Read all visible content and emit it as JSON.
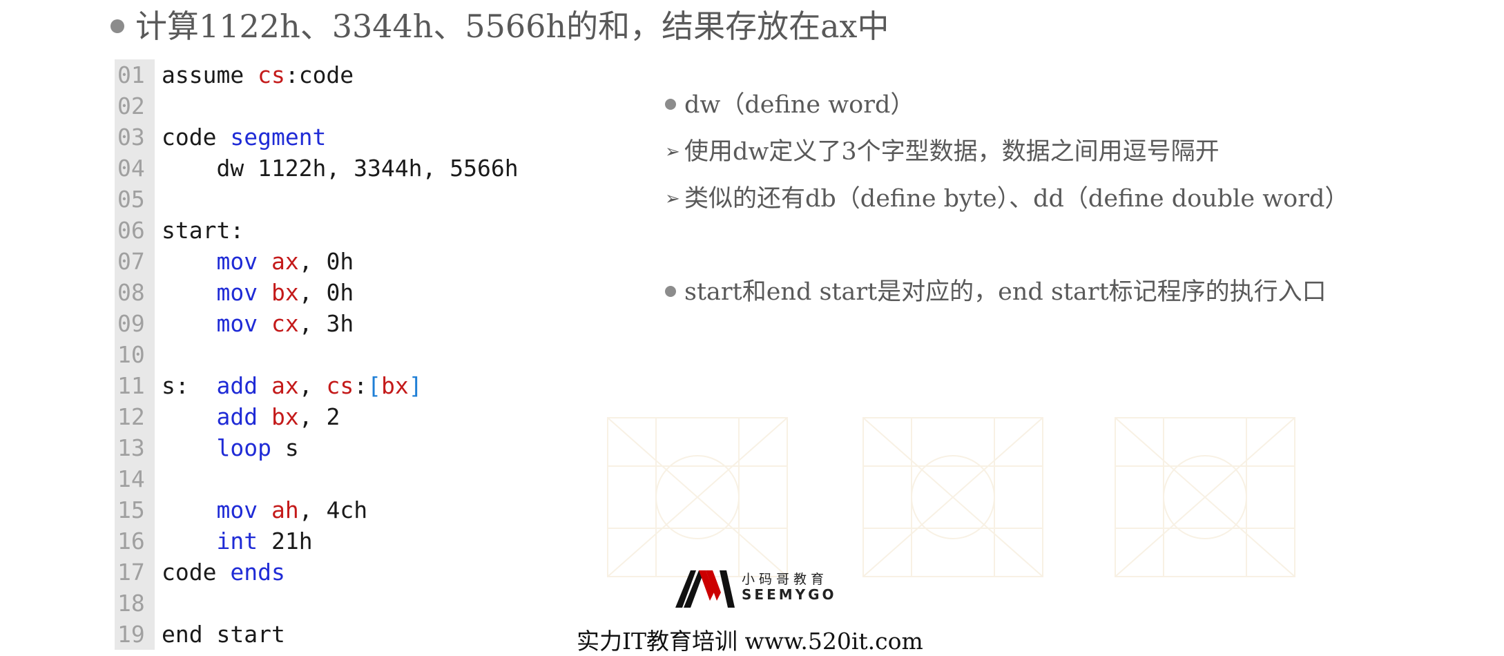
{
  "title": "计算1122h、3344h、5566h的和，结果存放在ax中",
  "code_lines": [
    {
      "num": "01",
      "tokens": [
        {
          "t": "assume ",
          "c": "n"
        },
        {
          "t": "cs",
          "c": "reg"
        },
        {
          "t": ":code",
          "c": "n"
        }
      ]
    },
    {
      "num": "02",
      "tokens": []
    },
    {
      "num": "03",
      "tokens": [
        {
          "t": "code ",
          "c": "n"
        },
        {
          "t": "segment",
          "c": "kw"
        }
      ]
    },
    {
      "num": "04",
      "tokens": [
        {
          "t": "    dw 1122h, 3344h, 5566h",
          "c": "n"
        }
      ]
    },
    {
      "num": "05",
      "tokens": []
    },
    {
      "num": "06",
      "tokens": [
        {
          "t": "start:",
          "c": "n"
        }
      ]
    },
    {
      "num": "07",
      "tokens": [
        {
          "t": "    ",
          "c": "n"
        },
        {
          "t": "mov",
          "c": "kw"
        },
        {
          "t": " ",
          "c": "n"
        },
        {
          "t": "ax",
          "c": "reg"
        },
        {
          "t": ", 0h",
          "c": "n"
        }
      ]
    },
    {
      "num": "08",
      "tokens": [
        {
          "t": "    ",
          "c": "n"
        },
        {
          "t": "mov",
          "c": "kw"
        },
        {
          "t": " ",
          "c": "n"
        },
        {
          "t": "bx",
          "c": "reg"
        },
        {
          "t": ", 0h",
          "c": "n"
        }
      ]
    },
    {
      "num": "09",
      "tokens": [
        {
          "t": "    ",
          "c": "n"
        },
        {
          "t": "mov",
          "c": "kw"
        },
        {
          "t": " ",
          "c": "n"
        },
        {
          "t": "cx",
          "c": "reg"
        },
        {
          "t": ", 3h",
          "c": "n"
        }
      ]
    },
    {
      "num": "10",
      "tokens": []
    },
    {
      "num": "11",
      "tokens": [
        {
          "t": "s:  ",
          "c": "n"
        },
        {
          "t": "add",
          "c": "kw"
        },
        {
          "t": " ",
          "c": "n"
        },
        {
          "t": "ax",
          "c": "reg"
        },
        {
          "t": ", ",
          "c": "n"
        },
        {
          "t": "cs",
          "c": "reg"
        },
        {
          "t": ":",
          "c": "n"
        },
        {
          "t": "[",
          "c": "br"
        },
        {
          "t": "bx",
          "c": "reg"
        },
        {
          "t": "]",
          "c": "br"
        }
      ]
    },
    {
      "num": "12",
      "tokens": [
        {
          "t": "    ",
          "c": "n"
        },
        {
          "t": "add",
          "c": "kw"
        },
        {
          "t": " ",
          "c": "n"
        },
        {
          "t": "bx",
          "c": "reg"
        },
        {
          "t": ", 2",
          "c": "n"
        }
      ]
    },
    {
      "num": "13",
      "tokens": [
        {
          "t": "    ",
          "c": "n"
        },
        {
          "t": "loop",
          "c": "kw"
        },
        {
          "t": " s",
          "c": "n"
        }
      ]
    },
    {
      "num": "14",
      "tokens": []
    },
    {
      "num": "15",
      "tokens": [
        {
          "t": "    ",
          "c": "n"
        },
        {
          "t": "mov",
          "c": "kw"
        },
        {
          "t": " ",
          "c": "n"
        },
        {
          "t": "ah",
          "c": "reg"
        },
        {
          "t": ", 4ch",
          "c": "n"
        }
      ]
    },
    {
      "num": "16",
      "tokens": [
        {
          "t": "    ",
          "c": "n"
        },
        {
          "t": "int",
          "c": "kw"
        },
        {
          "t": " 21h",
          "c": "n"
        }
      ]
    },
    {
      "num": "17",
      "tokens": [
        {
          "t": "code ",
          "c": "n"
        },
        {
          "t": "ends",
          "c": "kw"
        }
      ]
    },
    {
      "num": "18",
      "tokens": []
    },
    {
      "num": "19",
      "tokens": [
        {
          "t": "end start",
          "c": "n"
        }
      ]
    }
  ],
  "notes": {
    "dw_heading": "dw（define word）",
    "dw_sub1": "使用dw定义了3个字型数据，数据之间用逗号隔开",
    "dw_sub2": "类似的还有db（define byte）、dd（define double word）",
    "start_end": "start和end start是对应的，end start标记程序的执行入口"
  },
  "logo": {
    "cn": "小码哥教育",
    "en": "SEEMYGO"
  },
  "slogan": "实力IT教育培训 www.520it.com",
  "colors": {
    "keyword": "#1f2bd6",
    "register": "#c41a1a",
    "bracket": "#1f7fd6",
    "line_number_bg": "#e8e8e8",
    "text": "#595959"
  }
}
